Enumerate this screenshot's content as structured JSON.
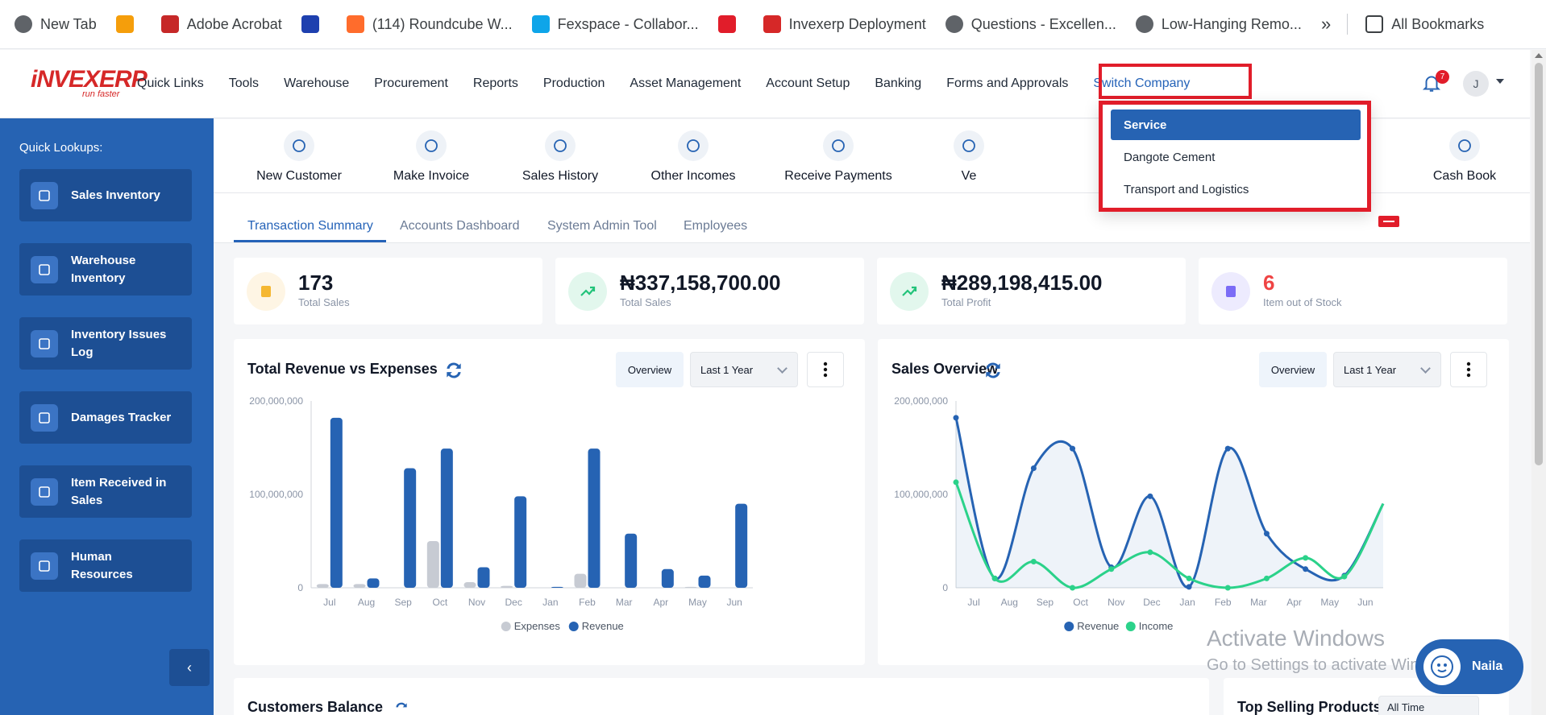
{
  "bookmarks": [
    {
      "label": "New Tab",
      "icon": "chrome-icon"
    },
    {
      "label": "",
      "icon": "lottery-logo-icon"
    },
    {
      "label": "Adobe Acrobat",
      "icon": "acrobat-icon"
    },
    {
      "label": "",
      "icon": "1x-icon"
    },
    {
      "label": "(114) Roundcube W...",
      "icon": "cpanel-icon"
    },
    {
      "label": "Fexspace - Collabor...",
      "icon": "fexspace-icon"
    },
    {
      "label": "",
      "icon": "youtube-icon"
    },
    {
      "label": "Invexerp Deployment",
      "icon": "invex-icon"
    },
    {
      "label": "Questions - Excellen...",
      "icon": "globe-icon"
    },
    {
      "label": "Low-Hanging Remo...",
      "icon": "globe-icon"
    }
  ],
  "bookmarks_more": "»",
  "all_bookmarks": "All Bookmarks",
  "app": {
    "logo_main": "iNVEXERP",
    "logo_tagline": "run faster",
    "nav": [
      "Quick Links",
      "Tools",
      "Warehouse",
      "Procurement",
      "Reports",
      "Production",
      "Asset Management",
      "Account Setup",
      "Banking",
      "Forms and Approvals",
      "Switch Company"
    ],
    "notification_count": "7",
    "avatar_initial": "J"
  },
  "switch_company_menu": {
    "items": [
      "Service",
      "Dangote Cement",
      "Transport and Logistics"
    ],
    "selected": "Service"
  },
  "sidebar": {
    "title": "Quick Lookups:",
    "items": [
      {
        "label": "Sales Inventory",
        "icon": "pie-chart-icon"
      },
      {
        "label": "Warehouse Inventory",
        "icon": "box-icon"
      },
      {
        "label": "Inventory Issues Log",
        "icon": "flag-icon"
      },
      {
        "label": "Damages Tracker",
        "icon": "route-icon"
      },
      {
        "label": "Item Received in Sales",
        "icon": "inbox-icon"
      },
      {
        "label": "Human Resources",
        "icon": "users-icon"
      }
    ],
    "collapse_glyph": "‹"
  },
  "quick_actions": [
    {
      "label": "New Customer",
      "icon": "user-icon"
    },
    {
      "label": "Make Invoice",
      "icon": "cart-icon"
    },
    {
      "label": "Sales History",
      "icon": "clock-icon"
    },
    {
      "label": "Other Incomes",
      "icon": "coins-icon"
    },
    {
      "label": "Receive Payments",
      "icon": "tag-icon"
    },
    {
      "label": "Ve",
      "icon": "vendor-icon"
    },
    {
      "label": "Cash Book",
      "icon": "message-icon"
    }
  ],
  "tabs": [
    "Transaction Summary",
    "Accounts Dashboard",
    "System Admin Tool",
    "Employees"
  ],
  "kpis": [
    {
      "value": "173",
      "label": "Total Sales",
      "icon": "invoice-icon",
      "color": "#f5b731"
    },
    {
      "value": "₦337,158,700.00",
      "label": "Total Sales",
      "icon": "trend-up-icon",
      "color": "#22c37a"
    },
    {
      "value": "₦289,198,415.00",
      "label": "Total Profit",
      "icon": "trend-up-icon",
      "color": "#22c37a"
    },
    {
      "value": "6",
      "label": "Item out of Stock",
      "icon": "archive-icon",
      "color": "#7b6cf6"
    }
  ],
  "revenue_expenses": {
    "title": "Total Revenue vs Expenses",
    "overview_label": "Overview",
    "range_label": "Last 1 Year"
  },
  "sales_overview": {
    "title": "Sales Overview",
    "overview_label": "Overview",
    "range_label": "Last 1 Year"
  },
  "chart_data": [
    {
      "type": "bar",
      "title": "Total Revenue vs Expenses",
      "categories": [
        "Jul",
        "Aug",
        "Sep",
        "Oct",
        "Nov",
        "Dec",
        "Jan",
        "Feb",
        "Mar",
        "Apr",
        "May",
        "Jun"
      ],
      "category_labels_shown": [
        "Jul",
        "Aug",
        "Sep",
        "Oct",
        "Nov",
        "Dec",
        "Jan",
        "Feb",
        "Mar",
        "Apr",
        "May",
        "Jun"
      ],
      "yticks": [
        "0",
        "100,000,000",
        "200,000,000"
      ],
      "ylim": [
        0,
        200000000
      ],
      "series": [
        {
          "name": "Expenses",
          "color": "#c7cbd3",
          "values": [
            4000000,
            4000000,
            0,
            50000000,
            6000000,
            2000000,
            0,
            15000000,
            0,
            0,
            1000000,
            0
          ]
        },
        {
          "name": "Revenue",
          "color": "#2663b3",
          "values": [
            182000000,
            10000000,
            128000000,
            149000000,
            22000000,
            98000000,
            1000000,
            149000000,
            58000000,
            20000000,
            13000000,
            90000000
          ]
        }
      ],
      "legend": "bottom"
    },
    {
      "type": "area",
      "title": "Sales Overview",
      "categories": [
        "Jul",
        "Aug",
        "Sep",
        "Oct",
        "Nov",
        "Dec",
        "Jan",
        "Feb",
        "Mar",
        "Apr",
        "May",
        "Jun"
      ],
      "category_labels_shown": [
        "Jul",
        "Aug",
        "Sep",
        "Oct",
        "Nov",
        "Dec",
        "Jan",
        "Feb",
        "Mar",
        "Apr",
        "May",
        "Jun"
      ],
      "yticks": [
        "0",
        "100,000,000",
        "200,000,000"
      ],
      "ylim": [
        0,
        200000000
      ],
      "series": [
        {
          "name": "Revenue",
          "color": "#2663b3",
          "values": [
            182000000,
            10000000,
            128000000,
            149000000,
            22000000,
            98000000,
            1000000,
            149000000,
            58000000,
            20000000,
            13000000,
            90000000
          ]
        },
        {
          "name": "Income",
          "color": "#2bd28a",
          "values": [
            113000000,
            10000000,
            28000000,
            0,
            20000000,
            38000000,
            10000000,
            0,
            10000000,
            32000000,
            12000000,
            90000000
          ]
        }
      ],
      "legend": "bottom"
    }
  ],
  "bottom": {
    "customers_balance": "Customers Balance",
    "top_selling": "Top Selling Products",
    "top_selling_range": "All Time"
  },
  "watermark": {
    "line1": "Activate Windows",
    "line2": "Go to Settings to activate Windows."
  },
  "chat": {
    "name": "Naila"
  }
}
